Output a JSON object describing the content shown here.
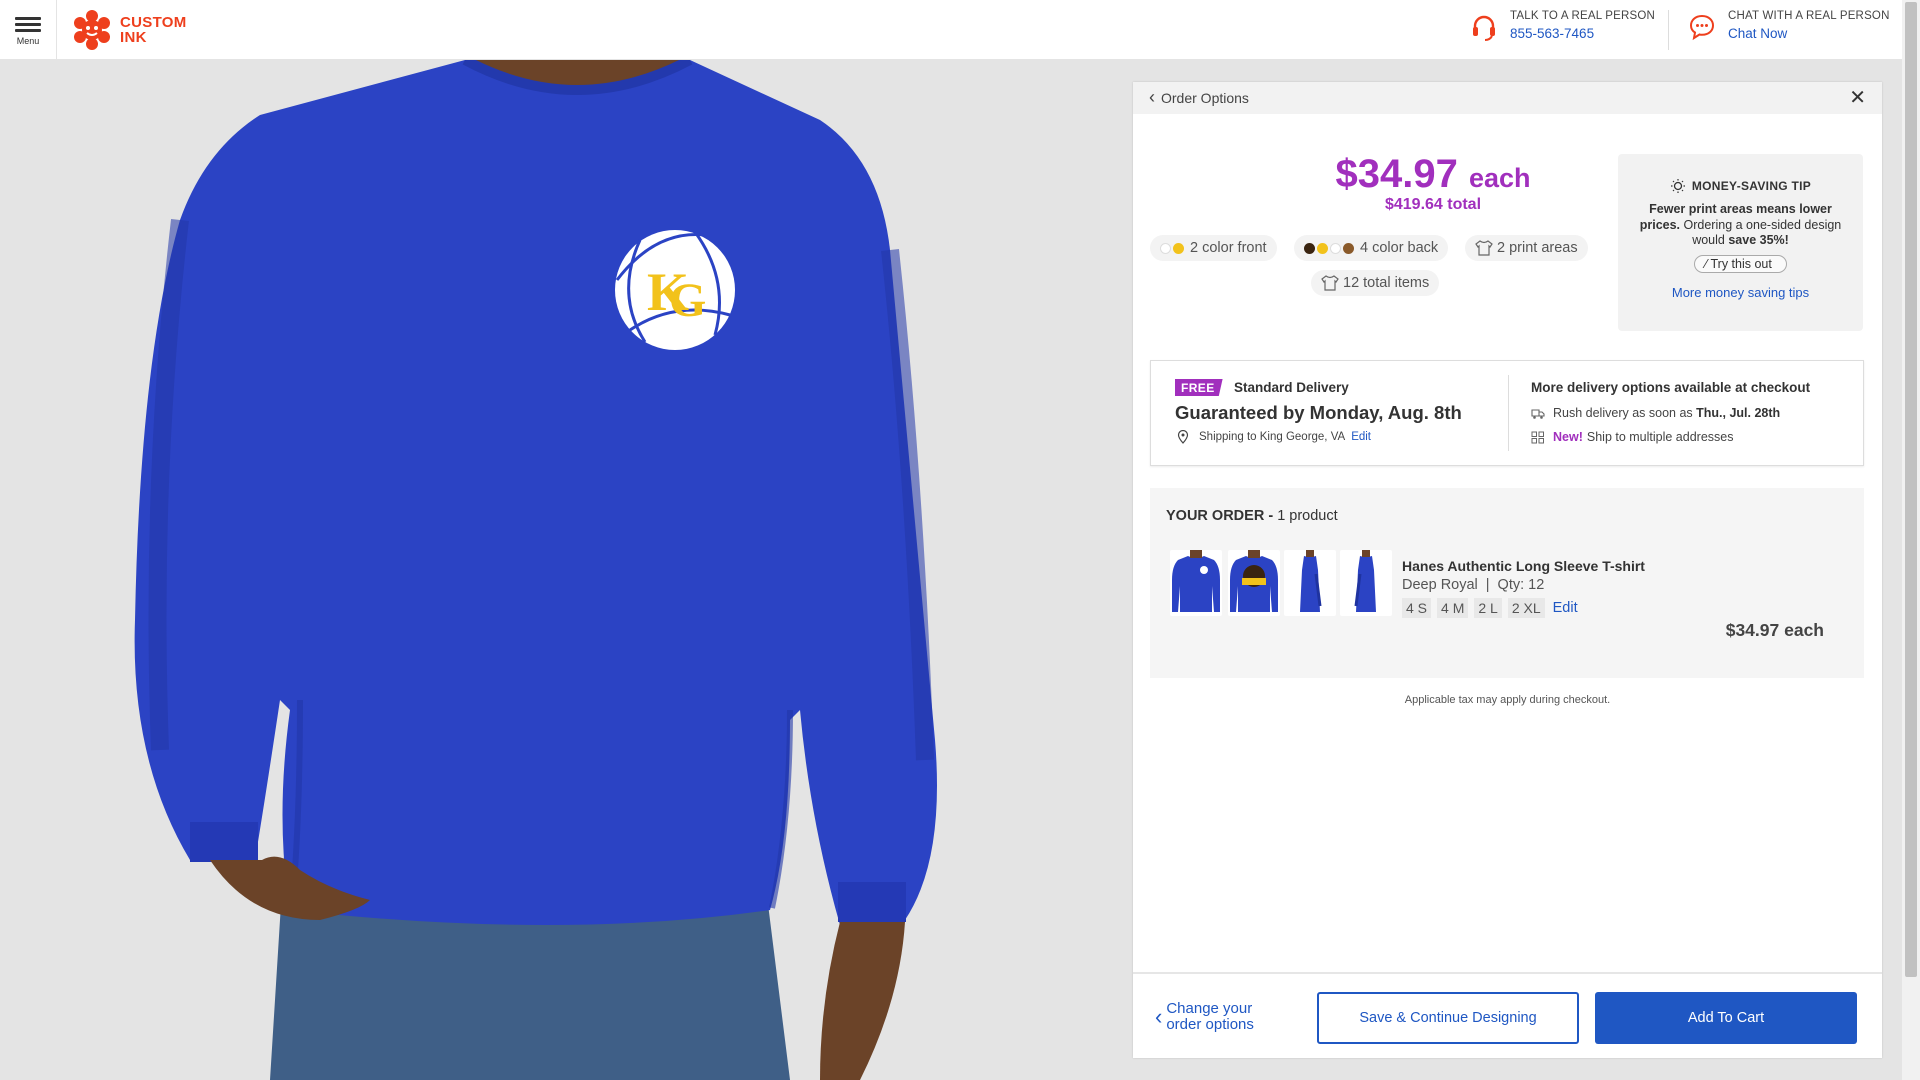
{
  "header": {
    "menu_label": "Menu",
    "logo_line1": "CUSTOM",
    "logo_line2": "INK",
    "phone": {
      "label": "TALK TO A REAL PERSON",
      "number": "855-563-7465"
    },
    "chat": {
      "label": "CHAT WITH A REAL PERSON",
      "link": "Chat Now"
    }
  },
  "colors": {
    "brand_red": "#ee3f1d",
    "link_blue": "#1f57c3",
    "price_purple": "#a12fbd",
    "shirt_blue": "#2b43c4",
    "logo_gold": "#f2c21b"
  },
  "panel": {
    "back_label": "Order Options",
    "close_icon": "close-icon",
    "price_each": "$34.97",
    "price_each_suffix": "each",
    "price_total": "$419.64 total",
    "pills": {
      "front": "2 color front",
      "back": "4 color back",
      "areas": "2 print areas",
      "items": "12 total items"
    },
    "tip": {
      "title": "MONEY-SAVING TIP",
      "body_bold": "Fewer print areas means lower prices.",
      "body_text": "Ordering a one-sided design would",
      "body_save": "save 35%!",
      "try_label": "Try this out",
      "more_link": "More money saving tips"
    },
    "delivery": {
      "badge": "FREE",
      "standard": "Standard Delivery",
      "guaranteed": "Guaranteed by Monday, Aug. 8th",
      "shipping_to": "Shipping to King George, VA",
      "edit": "Edit",
      "more_title": "More delivery options available at checkout",
      "rush_text": "Rush delivery as soon as",
      "rush_date": "Thu., Jul. 28th",
      "new_label": "New!",
      "multi_text": "Ship to multiple addresses"
    },
    "order": {
      "title": "YOUR ORDER -",
      "count": "1 product",
      "product_name": "Hanes Authentic Long Sleeve T-shirt",
      "color": "Deep Royal",
      "qty": "Qty: 12",
      "sizes": [
        "4 S",
        "4 M",
        "2 L",
        "2 XL"
      ],
      "edit": "Edit",
      "price": "$34.97 each"
    },
    "tax_note": "Applicable tax may apply during checkout.",
    "footer": {
      "change_line1": "Change your",
      "change_line2": "order options",
      "save_label": "Save & Continue Designing",
      "cart_label": "Add To Cart"
    }
  }
}
